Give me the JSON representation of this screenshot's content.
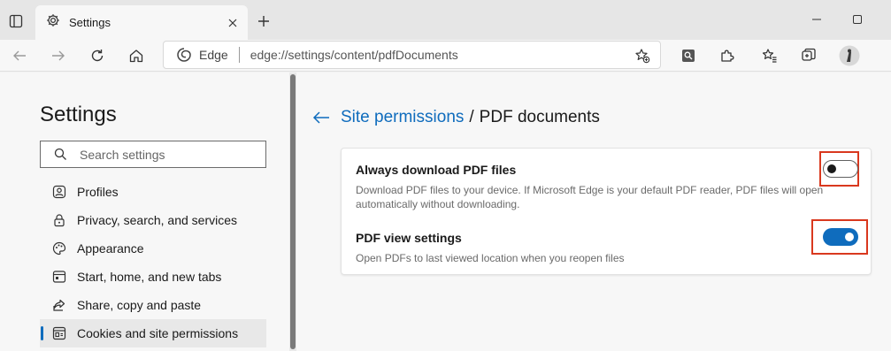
{
  "browser": {
    "tab_title": "Settings",
    "address": {
      "site_label": "Edge",
      "url": "edge://settings/content/pdfDocuments"
    }
  },
  "sidebar": {
    "title": "Settings",
    "search_placeholder": "Search settings",
    "items": [
      {
        "label": "Profiles",
        "icon": "profile-icon",
        "active": false
      },
      {
        "label": "Privacy, search, and services",
        "icon": "lock-icon",
        "active": false
      },
      {
        "label": "Appearance",
        "icon": "palette-icon",
        "active": false
      },
      {
        "label": "Start, home, and new tabs",
        "icon": "home-tabs-icon",
        "active": false
      },
      {
        "label": "Share, copy and paste",
        "icon": "share-icon",
        "active": false
      },
      {
        "label": "Cookies and site permissions",
        "icon": "cookie-icon",
        "active": true
      }
    ]
  },
  "main": {
    "breadcrumb": {
      "parent": "Site permissions",
      "separator": "/",
      "current": "PDF documents"
    },
    "settings": [
      {
        "title": "Always download PDF files",
        "description_line1": "Download PDF files to your device. If Microsoft Edge is your default PDF reader, PDF files will open",
        "description_line2": "automatically without downloading.",
        "enabled": false
      },
      {
        "title": "PDF view settings",
        "description": "Open PDFs to last viewed location when you reopen files",
        "enabled": true
      }
    ]
  },
  "colors": {
    "accent": "#0f6cbd",
    "highlight_box": "#d9381e"
  }
}
